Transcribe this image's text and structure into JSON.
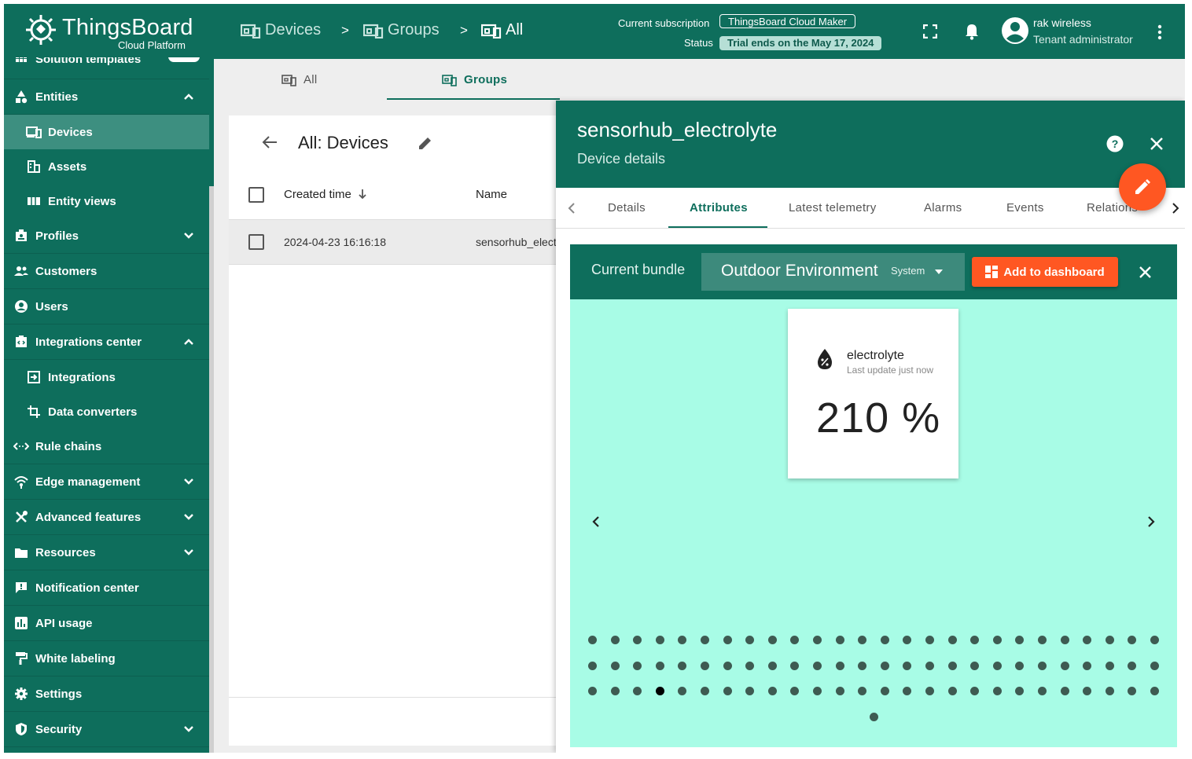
{
  "brand": {
    "title": "ThingsBoard",
    "subtitle": "Cloud Platform"
  },
  "sidebar": {
    "partial_item": "Solution templates",
    "items": [
      {
        "label": "Entities",
        "icon": "entities-icon",
        "expand": "up"
      },
      {
        "label": "Devices",
        "icon": "devices-icon",
        "sub": true,
        "active": true
      },
      {
        "label": "Assets",
        "icon": "assets-icon",
        "sub": true
      },
      {
        "label": "Entity views",
        "icon": "entity-views-icon",
        "sub": true
      },
      {
        "label": "Profiles",
        "icon": "profiles-icon",
        "expand": "down"
      },
      {
        "label": "Customers",
        "icon": "customers-icon"
      },
      {
        "label": "Users",
        "icon": "users-icon"
      },
      {
        "label": "Integrations center",
        "icon": "integrations-center-icon",
        "expand": "up"
      },
      {
        "label": "Integrations",
        "icon": "integrations-icon",
        "sub": true
      },
      {
        "label": "Data converters",
        "icon": "data-converters-icon",
        "sub": true
      },
      {
        "label": "Rule chains",
        "icon": "rule-chains-icon"
      },
      {
        "label": "Edge management",
        "icon": "edge-icon",
        "expand": "down"
      },
      {
        "label": "Advanced features",
        "icon": "advanced-features-icon",
        "expand": "down"
      },
      {
        "label": "Resources",
        "icon": "resources-icon",
        "expand": "down"
      },
      {
        "label": "Notification center",
        "icon": "notification-center-icon"
      },
      {
        "label": "API usage",
        "icon": "api-usage-icon"
      },
      {
        "label": "White labeling",
        "icon": "white-labeling-icon"
      },
      {
        "label": "Settings",
        "icon": "settings-icon"
      },
      {
        "label": "Security",
        "icon": "security-icon",
        "expand": "down"
      }
    ]
  },
  "topbar": {
    "breadcrumbs": [
      "Devices",
      "Groups",
      "All"
    ],
    "separator": ">",
    "subscription_label": "Current subscription",
    "subscription_value": "ThingsBoard Cloud Maker",
    "status_label": "Status",
    "status_value": "Trial ends on the May 17, 2024",
    "user_name": "rak wireless",
    "user_role": "Tenant administrator"
  },
  "group_tabs": {
    "all": "All",
    "groups": "Groups"
  },
  "device_list": {
    "title": "All: Devices",
    "columns": {
      "created": "Created time",
      "name": "Name"
    },
    "rows": [
      {
        "created": "2024-04-23 16:16:18",
        "name": "sensorhub_elect"
      }
    ]
  },
  "details": {
    "title": "sensorhub_electrolyte",
    "subtitle": "Device details",
    "tabs": [
      "Details",
      "Attributes",
      "Latest telemetry",
      "Alarms",
      "Events",
      "Relations"
    ],
    "active_tab": "Attributes"
  },
  "bundle": {
    "label": "Current bundle",
    "selected": "Outdoor Environment",
    "tag": "System",
    "add_button": "Add to dashboard"
  },
  "widget": {
    "label": "electrolyte",
    "last_update": "Last update just now",
    "value": "210 %"
  },
  "pagination": {
    "total_pages": 79,
    "active_page": 55
  },
  "colors": {
    "primary": "#0e6e5c",
    "accent": "#ff5722",
    "bundle_bg": "#a8fce6"
  }
}
